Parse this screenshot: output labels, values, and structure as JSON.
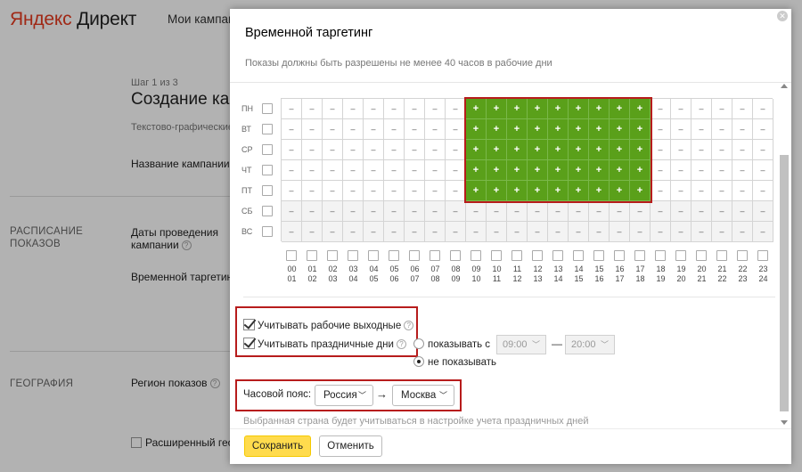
{
  "background": {
    "logo_part1": "Яндекс",
    "logo_part2": "Директ",
    "nav_item": "Мои кампан",
    "step": "Шаг 1 из 3",
    "heading": "Создание ка",
    "campaign_type": "Текстово-графические",
    "campaign_name_label": "Название кампании",
    "section_schedule": "РАСПИСАНИЕ ПОКАЗОВ",
    "dates_label": "Даты проведения кампании",
    "time_targeting_label": "Временной таргетинг",
    "section_geo": "ГЕОГРАФИЯ",
    "region_label": "Регион показов",
    "extended_geo_label": "Расширенный геог"
  },
  "modal": {
    "title": "Временной таргетинг",
    "subtitle": "Показы должны быть разрешены не менее 40 часов в рабочие дни",
    "close_icon": "close-icon",
    "days": [
      "ПН",
      "ВТ",
      "СР",
      "ЧТ",
      "ПТ",
      "СБ",
      "ВС"
    ],
    "hour_starts": [
      "00",
      "01",
      "02",
      "03",
      "04",
      "05",
      "06",
      "07",
      "08",
      "09",
      "10",
      "11",
      "12",
      "13",
      "14",
      "15",
      "16",
      "17",
      "18",
      "19",
      "20",
      "21",
      "22",
      "23"
    ],
    "hour_ends": [
      "01",
      "02",
      "03",
      "04",
      "05",
      "06",
      "07",
      "08",
      "09",
      "10",
      "11",
      "12",
      "13",
      "14",
      "15",
      "16",
      "17",
      "18",
      "19",
      "20",
      "21",
      "22",
      "23",
      "24"
    ],
    "on_symbol": "+",
    "off_symbol": "–",
    "schedule": {
      "enabled_days": [
        0,
        1,
        2,
        3,
        4
      ],
      "enabled_hours_from": 9,
      "enabled_hours_to": 17
    },
    "colors": {
      "enabled": "#5aa01a",
      "highlight": "#b71c1c"
    },
    "options": {
      "work_weekends_label": "Учитывать рабочие выходные",
      "holidays_label": "Учитывать праздничные дни",
      "show_label": "показывать с",
      "time_from": "09:00",
      "time_to": "20:00",
      "dash": "—",
      "no_show_label": "не показывать"
    },
    "timezone": {
      "label": "Часовой пояс:",
      "country": "Россия",
      "arrow": "→",
      "city": "Москва",
      "note": "Выбранная страна будет учитываться в настройке учета праздничных дней"
    },
    "buttons": {
      "save": "Сохранить",
      "cancel": "Отменить"
    }
  }
}
